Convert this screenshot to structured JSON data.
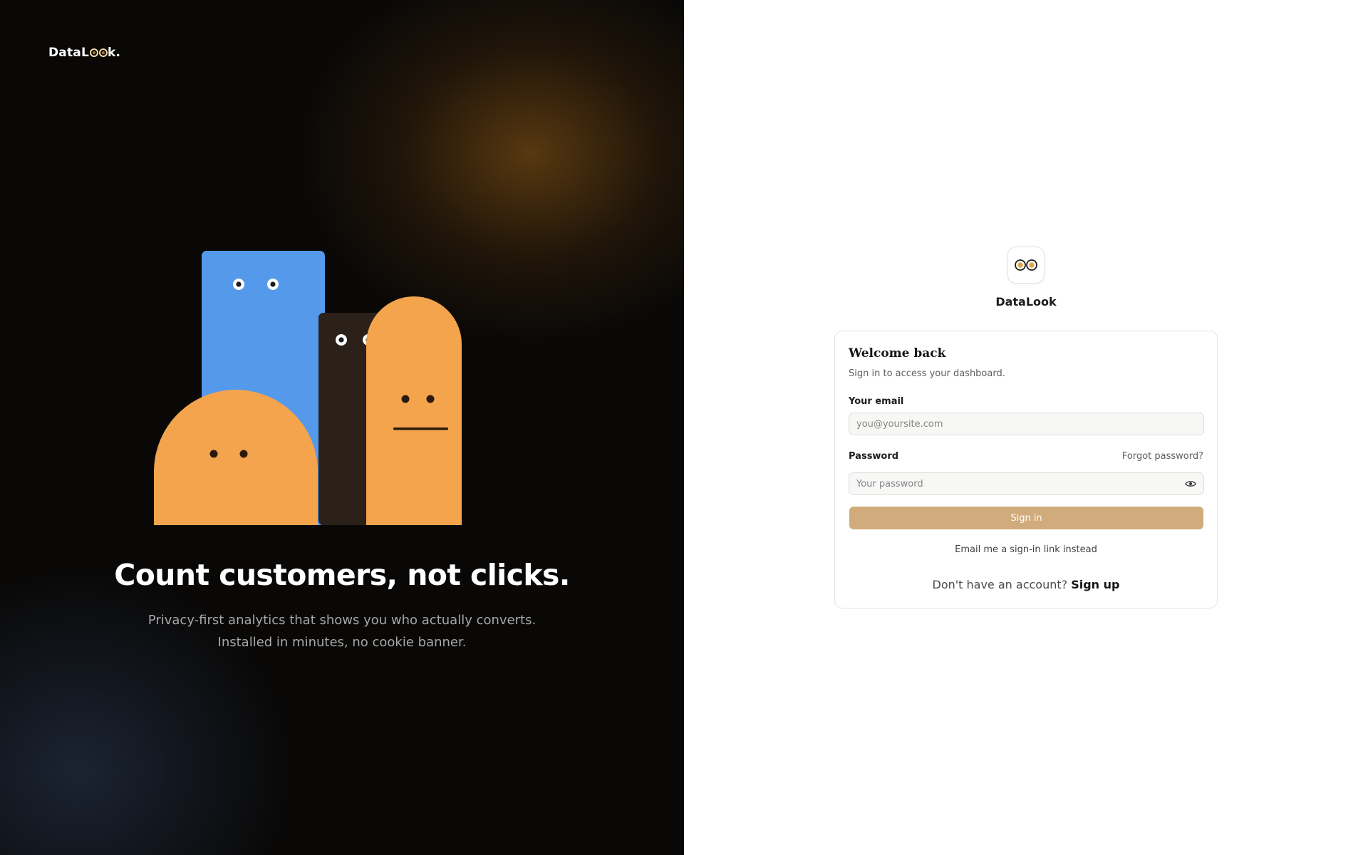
{
  "hero": {
    "brand": {
      "prefix": "DataL",
      "suffix": "k."
    },
    "headline": "Count customers, not clicks.",
    "subline_1": "Privacy-first analytics that shows you who actually converts.",
    "subline_2": "Installed in minutes, no cookie banner.",
    "illustration_colors": {
      "blue": "#5599ea",
      "dark": "#2b2119",
      "orange": "#f3a44c"
    }
  },
  "auth": {
    "app_name": "DataLook",
    "card": {
      "title": "Welcome back",
      "subtitle": "Sign in to access your dashboard.",
      "email_label": "Your email",
      "email_placeholder": "you@yoursite.com",
      "password_label": "Password",
      "forgot_label": "Forgot password?",
      "password_placeholder": "Your password",
      "signin_label": "Sign in",
      "email_link_label": "Email me a sign-in link instead",
      "no_account_text": "Don't have an account?",
      "signup_label": "Sign up"
    },
    "colors": {
      "accent": "#d1ab7b"
    }
  }
}
